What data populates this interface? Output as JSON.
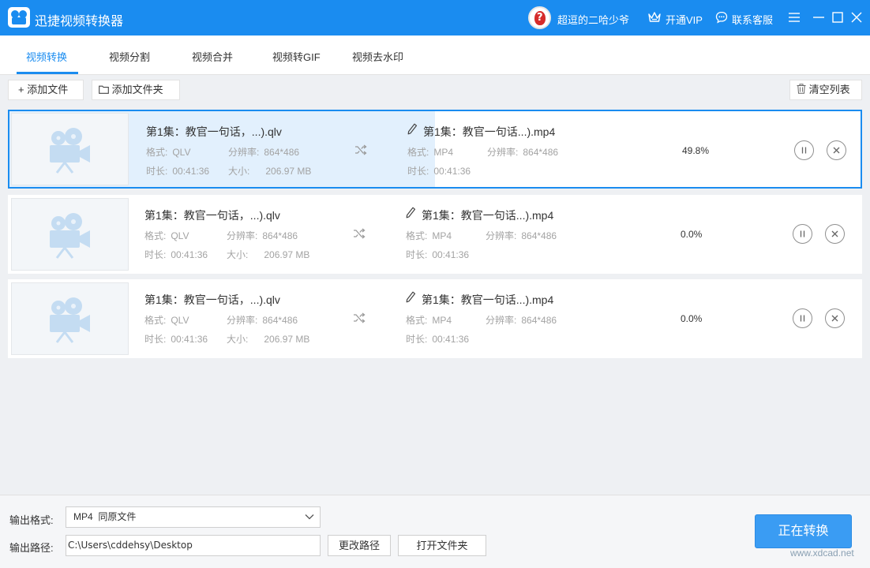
{
  "window": {
    "title": "迅捷视频转换器",
    "username": "超逗的二哈少爷",
    "vip_label": "开通VIP",
    "service_label": "联系客服"
  },
  "tabs": [
    {
      "label": "视频转换",
      "active": true
    },
    {
      "label": "视频分割",
      "active": false
    },
    {
      "label": "视频合并",
      "active": false
    },
    {
      "label": "视频转GIF",
      "active": false
    },
    {
      "label": "视频去水印",
      "active": false
    }
  ],
  "toolbar": {
    "add_file": "+ 添加文件",
    "add_folder": "添加文件夹",
    "clear_list": "清空列表"
  },
  "labels": {
    "format": "格式:",
    "resolution": "分辨率:",
    "duration": "时长:",
    "size": "大小:"
  },
  "files": [
    {
      "source_name": "第1集：教官一句话，...).qlv",
      "source_format": "QLV",
      "source_resolution": "864*486",
      "source_duration": "00:41:36",
      "source_size": "206.97 MB",
      "output_name": "第1集：教官一句话...).mp4",
      "output_format": "MP4",
      "output_resolution": "864*486",
      "output_duration": "00:41:36",
      "progress": "49.8%",
      "progress_fraction": 0.498
    },
    {
      "source_name": "第1集：教官一句话，...).qlv",
      "source_format": "QLV",
      "source_resolution": "864*486",
      "source_duration": "00:41:36",
      "source_size": "206.97 MB",
      "output_name": "第1集：教官一句话...).mp4",
      "output_format": "MP4",
      "output_resolution": "864*486",
      "output_duration": "00:41:36",
      "progress": "0.0%",
      "progress_fraction": 0
    },
    {
      "source_name": "第1集：教官一句话，...).qlv",
      "source_format": "QLV",
      "source_resolution": "864*486",
      "source_duration": "00:41:36",
      "source_size": "206.97 MB",
      "output_name": "第1集：教官一句话...).mp4",
      "output_format": "MP4",
      "output_resolution": "864*486",
      "output_duration": "00:41:36",
      "progress": "0.0%",
      "progress_fraction": 0
    }
  ],
  "bottom": {
    "format_label": "输出格式:",
    "format_value": "MP4  同原文件",
    "path_label": "输出路径:",
    "path_value": "C:\\Users\\cddehsy\\Desktop",
    "change_path": "更改路径",
    "open_folder": "打开文件夹",
    "convert_button": "正在转换"
  },
  "watermark": "www.xdcad.net",
  "colors": {
    "accent": "#1a8cf0",
    "progress_fill": "#e2f0fd"
  }
}
